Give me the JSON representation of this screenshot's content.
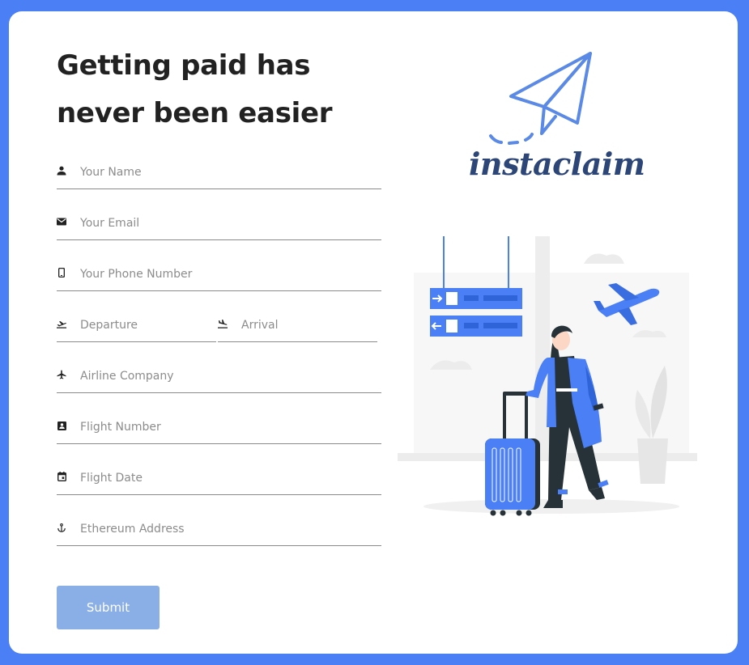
{
  "heading": {
    "line1": "Getting paid has",
    "line2": "never been easier"
  },
  "form": {
    "name": {
      "placeholder": "Your Name",
      "icon": "person-icon"
    },
    "email": {
      "placeholder": "Your Email",
      "icon": "mail-icon"
    },
    "phone": {
      "placeholder": "Your Phone Number",
      "icon": "phone-icon"
    },
    "departure": {
      "placeholder": "Departure",
      "icon": "flight-takeoff-icon"
    },
    "arrival": {
      "placeholder": "Arrival",
      "icon": "flight-land-icon"
    },
    "airline": {
      "placeholder": "Airline Company",
      "icon": "airplane-icon"
    },
    "flight_number": {
      "placeholder": "Flight Number",
      "icon": "badge-icon"
    },
    "flight_date": {
      "placeholder": "Flight Date",
      "icon": "calendar-icon"
    },
    "eth_address": {
      "placeholder": "Ethereum Address",
      "icon": "anchor-icon"
    },
    "submit_label": "Submit"
  },
  "brand": {
    "name": "instaclaim",
    "icon": "paper-plane-icon",
    "color": "#2d4678",
    "accent": "#4a7ff5"
  },
  "illustration": {
    "icon": "traveler-illustration"
  },
  "colors": {
    "background": "#4a7ff5",
    "button": "#8aaee6",
    "heading": "#222222"
  }
}
